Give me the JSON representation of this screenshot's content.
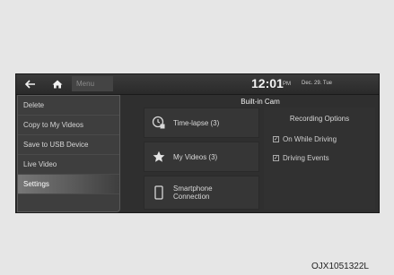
{
  "topbar": {
    "back_icon": "back-arrow-icon",
    "home_icon": "home-icon",
    "menu_label": "Menu",
    "time": "12:01",
    "ampm": "PM",
    "date": "Dec. 29. Tue"
  },
  "main": {
    "section_title": "Built-in Cam",
    "tiles": [
      {
        "label": "Time-lapse (3)",
        "icon": "timelapse-icon"
      },
      {
        "label": "My Videos (3)",
        "icon": "star-icon"
      },
      {
        "label_line1": "Smartphone",
        "label_line2": "Connection",
        "icon": "smartphone-icon"
      }
    ],
    "options": {
      "title": "Recording Options",
      "items": [
        {
          "label": "On While Driving",
          "checked": true
        },
        {
          "label": "Driving Events",
          "checked": true
        }
      ]
    }
  },
  "menu": {
    "items": [
      {
        "label": "Delete"
      },
      {
        "label": "Copy to My Videos"
      },
      {
        "label": "Save to USB Device"
      },
      {
        "label": "Live Video"
      },
      {
        "label": "Settings",
        "active": true
      }
    ]
  },
  "caption": "OJX1051322L"
}
